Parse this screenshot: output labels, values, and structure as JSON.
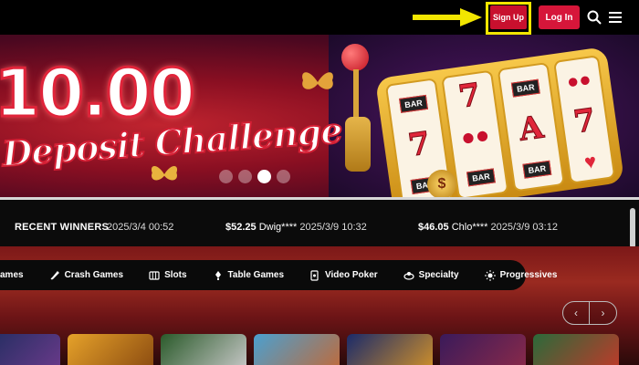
{
  "header": {
    "signup_label": "Sign Up",
    "login_label": "Log In",
    "highlight_color": "#f2e600",
    "button_color": "#d6163a",
    "icons": [
      "search-icon",
      "menu-icon"
    ]
  },
  "hero": {
    "amount_text": "10.00",
    "subtitle": "Deposit Challenge",
    "carousel_dots": 4,
    "active_dot": 3
  },
  "winners": {
    "title": "RECENT WINNERS",
    "entries": [
      {
        "amount": "",
        "name": "",
        "time": "2025/3/4 00:52"
      },
      {
        "amount": "$52.25",
        "name": "Dwig****",
        "time": "2025/3/9 10:32"
      },
      {
        "amount": "$46.05",
        "name": "Chlo****",
        "time": "2025/3/9 03:12"
      }
    ]
  },
  "categories": [
    {
      "label": "ames",
      "icon": "games-icon"
    },
    {
      "label": "Crash Games",
      "icon": "rocket-icon"
    },
    {
      "label": "Slots",
      "icon": "slot-icon"
    },
    {
      "label": "Table Games",
      "icon": "cards-icon"
    },
    {
      "label": "Video Poker",
      "icon": "poker-icon"
    },
    {
      "label": "Specialty",
      "icon": "specialty-icon"
    },
    {
      "label": "Progressives",
      "icon": "progressive-icon"
    }
  ],
  "carousel_nav": {
    "prev": "‹",
    "next": "›"
  }
}
